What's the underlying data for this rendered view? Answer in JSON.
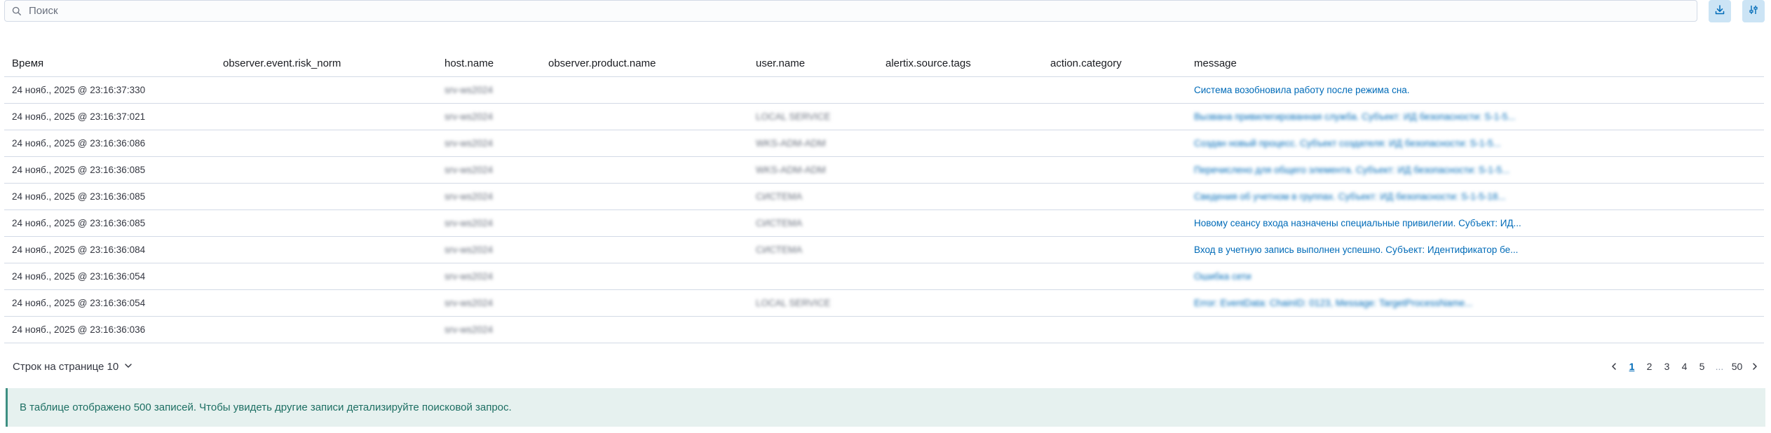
{
  "search": {
    "placeholder": "Поиск",
    "icon": "search-icon"
  },
  "toolbar": {
    "download_icon": "download-icon",
    "settings_icon": "sliders-icon"
  },
  "table": {
    "columns": [
      "Время",
      "observer.event.risk_norm",
      "host.name",
      "observer.product.name",
      "user.name",
      "alertix.source.tags",
      "action.category",
      "message"
    ],
    "rows": [
      {
        "time": "24 нояб., 2025 @ 23:16:37:330",
        "host": "srv-ws2024",
        "user": "",
        "message": "Система возобновила работу после режима сна.",
        "message_blurred": false
      },
      {
        "time": "24 нояб., 2025 @ 23:16:37:021",
        "host": "srv-ws2024",
        "user": "LOCAL SERVICE",
        "message": "Вызвана привилегированная служба. Субъект: ИД безопасности: S-1-5...",
        "message_blurred": true
      },
      {
        "time": "24 нояб., 2025 @ 23:16:36:086",
        "host": "srv-ws2024",
        "user": "WKS-ADM-ADM",
        "message": "Создан новый процесс. Субъект создателя: ИД безопасности: S-1-5...",
        "message_blurred": true
      },
      {
        "time": "24 нояб., 2025 @ 23:16:36:085",
        "host": "srv-ws2024",
        "user": "WKS-ADM-ADM",
        "message": "Перечислено для общего элемента. Субъект: ИД безопасности: S-1-5...",
        "message_blurred": true
      },
      {
        "time": "24 нояб., 2025 @ 23:16:36:085",
        "host": "srv-ws2024",
        "user": "СИСТЕМА",
        "message": "Сведения об учетном в группах. Субъект: ИД безопасности: S-1-5-18...",
        "message_blurred": true
      },
      {
        "time": "24 нояб., 2025 @ 23:16:36:085",
        "host": "srv-ws2024",
        "user": "СИСТЕМА",
        "message": "Новому сеансу входа назначены специальные привилегии. Субъект: ИД...",
        "message_blurred": false
      },
      {
        "time": "24 нояб., 2025 @ 23:16:36:084",
        "host": "srv-ws2024",
        "user": "СИСТЕМА",
        "message": "Вход в учетную запись выполнен успешно. Субъект: Идентификатор бе...",
        "message_blurred": false
      },
      {
        "time": "24 нояб., 2025 @ 23:16:36:054",
        "host": "srv-ws2024",
        "user": "",
        "message": "Ошибка сети",
        "message_blurred": true
      },
      {
        "time": "24 нояб., 2025 @ 23:16:36:054",
        "host": "srv-ws2024",
        "user": "LOCAL SERVICE",
        "message": "Error: EventData: ChainID: 0123, Message: TargetProcessName...",
        "message_blurred": true
      },
      {
        "time": "24 нояб., 2025 @ 23:16:36:036",
        "host": "srv-ws2024",
        "user": "",
        "message": "",
        "message_blurred": false
      }
    ]
  },
  "pagination": {
    "rows_per_page_label": "Строк на странице 10",
    "pages": [
      "1",
      "2",
      "3",
      "4",
      "5"
    ],
    "ellipsis": "...",
    "last_page": "50",
    "active_page": "1"
  },
  "callout": {
    "text": "В таблице отображено 500 записей. Чтобы увидеть другие записи детализируйте поисковой запрос."
  },
  "colors": {
    "link": "#006bb8",
    "border": "#d3dae6",
    "callout_bg": "#e6f1ef",
    "callout_text": "#1d6f63",
    "button_bg": "#cce4f5"
  }
}
